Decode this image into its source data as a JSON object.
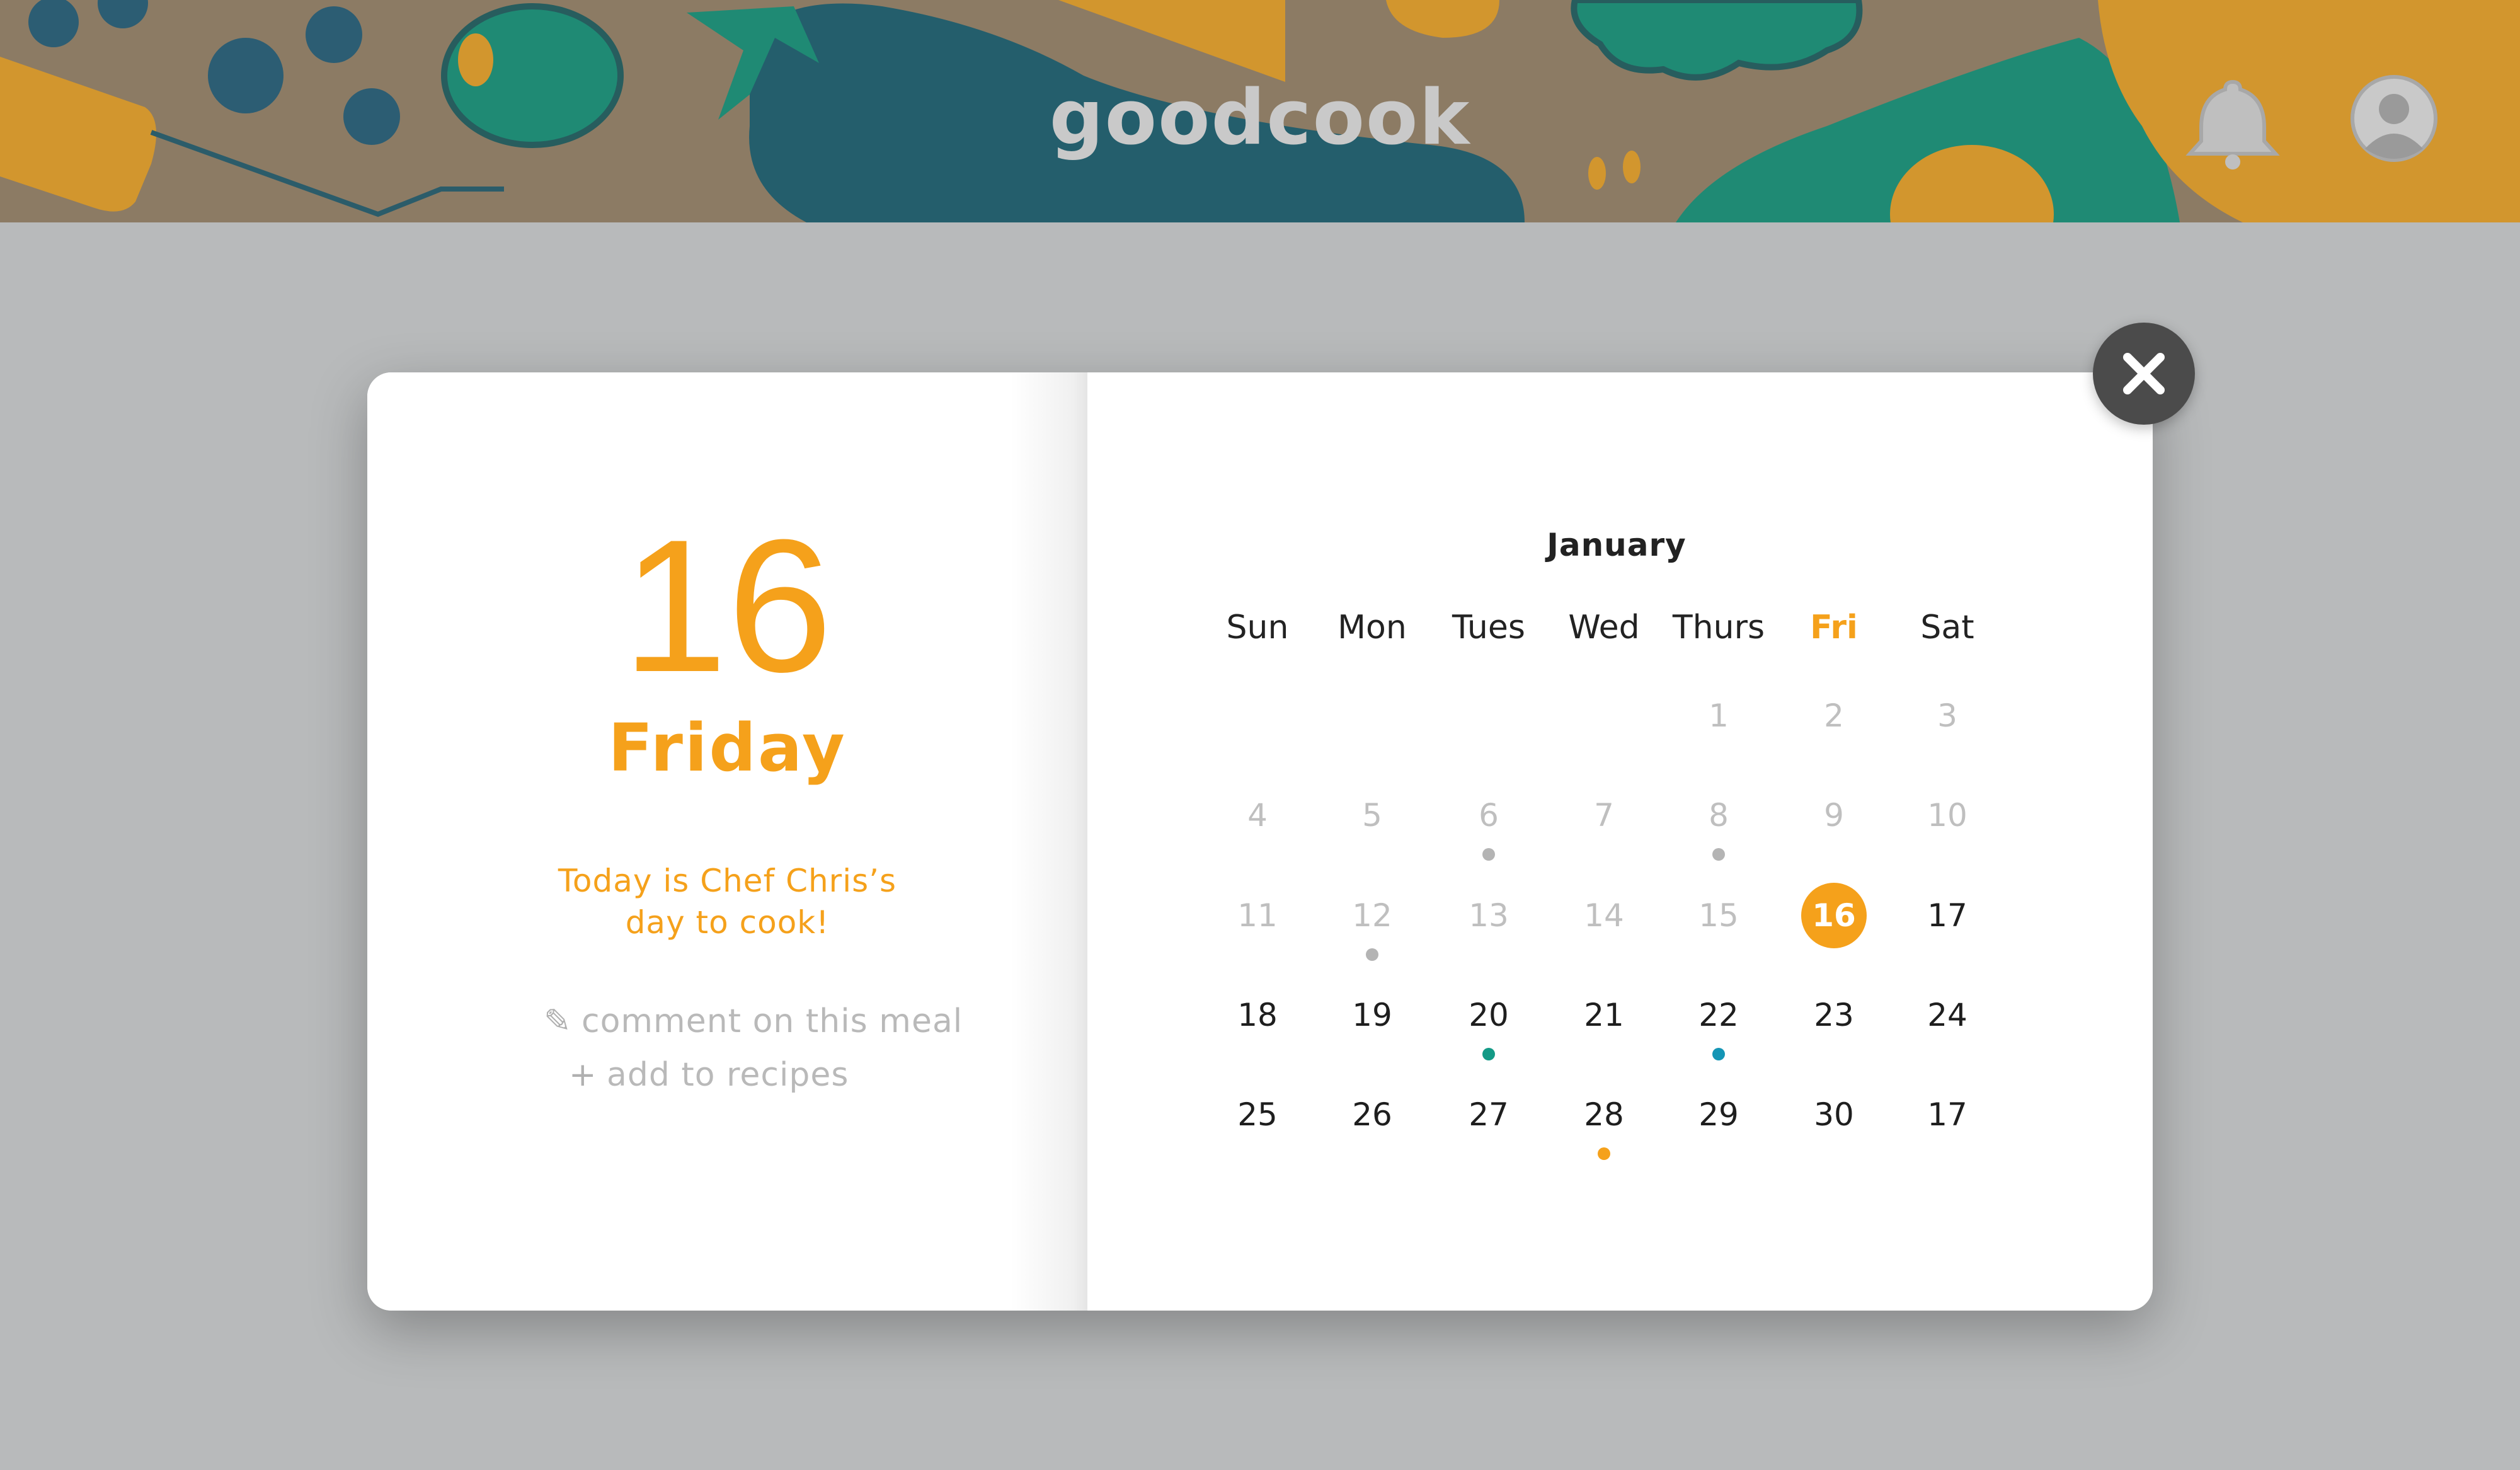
{
  "app": {
    "logo_text": "goodcook"
  },
  "header": {
    "icons": [
      "bell-icon",
      "user-avatar-icon"
    ]
  },
  "day_panel": {
    "day_number": "16",
    "weekday": "Friday",
    "note_line1": "Today is Chef Chris’s",
    "note_line2": "day to cook!",
    "actions": [
      {
        "icon": "pencil-icon",
        "label": "comment on this meal"
      },
      {
        "icon": "plus-icon",
        "label": "add to recipes"
      }
    ]
  },
  "calendar": {
    "month": "January",
    "weekdays": [
      "Sun",
      "Mon",
      "Tues",
      "Wed",
      "Thurs",
      "Fri",
      "Sat"
    ],
    "highlight_weekday": "Fri",
    "selected_day": "16",
    "weeks": [
      [
        "",
        "",
        "",
        "",
        "1",
        "2",
        "3"
      ],
      [
        "4",
        "5",
        "6",
        "7",
        "8",
        "9",
        "10"
      ],
      [
        "11",
        "12",
        "13",
        "14",
        "15",
        "16",
        "17"
      ],
      [
        "18",
        "19",
        "20",
        "21",
        "22",
        "23",
        "24"
      ],
      [
        "25",
        "26",
        "27",
        "28",
        "29",
        "30",
        "17"
      ]
    ],
    "past_days_until": 15,
    "event_dots": [
      {
        "week": 1,
        "col": 2,
        "color": "#b4b4b4"
      },
      {
        "week": 1,
        "col": 4,
        "color": "#b4b4b4"
      },
      {
        "week": 2,
        "col": 1,
        "color": "#b4b4b4"
      },
      {
        "week": 3,
        "col": 2,
        "color": "#139a86"
      },
      {
        "week": 3,
        "col": 4,
        "color": "#1495b5"
      },
      {
        "week": 4,
        "col": 3,
        "color": "#f5a11b"
      }
    ]
  },
  "colors": {
    "accent": "#f5a11b",
    "muted": "#bfbfbf",
    "overlay": "#b8babb",
    "header": "#8c7b64"
  },
  "close_button": {
    "icon": "close-icon"
  }
}
